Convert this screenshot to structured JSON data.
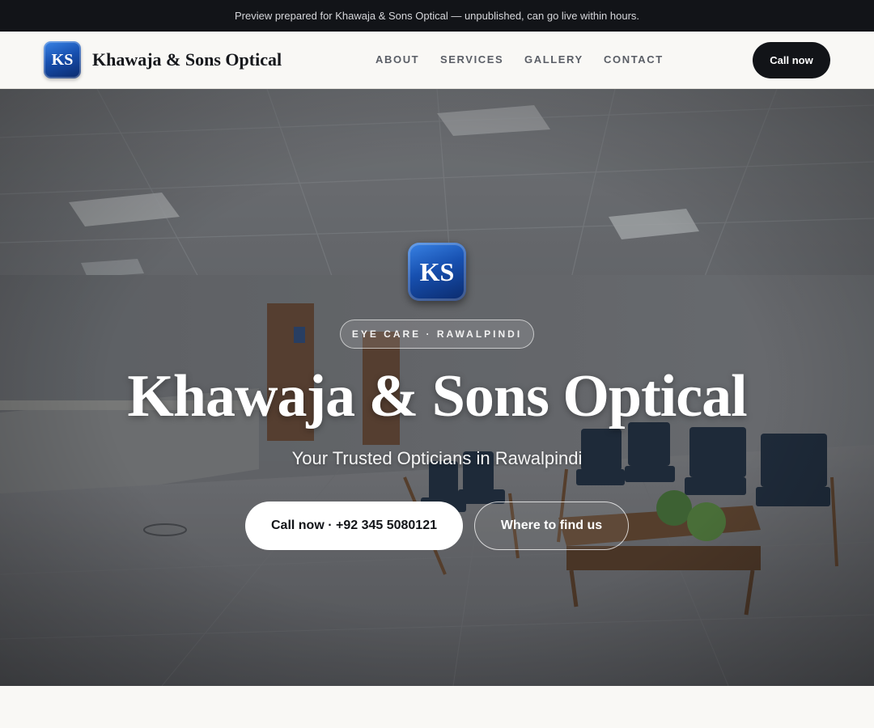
{
  "banner": {
    "text": "Preview prepared for Khawaja & Sons Optical — unpublished, can go live within hours."
  },
  "header": {
    "logo_text": "KS",
    "brand_name": "Khawaja & Sons Optical",
    "nav": [
      "ABOUT",
      "SERVICES",
      "GALLERY",
      "CONTACT"
    ],
    "call_label": "Call now"
  },
  "hero": {
    "logo_text": "KS",
    "tag": "EYE CARE · RAWALPINDI",
    "title": "Khawaja & Sons Optical",
    "subtitle": "Your Trusted Opticians in Rawalpindi",
    "primary_button": "Call now · +92 345 5080121",
    "secondary_button": "Where to find us"
  },
  "colors": {
    "dark": "#121418",
    "brand_blue": "#1750b0",
    "background": "#f9f8f5"
  }
}
